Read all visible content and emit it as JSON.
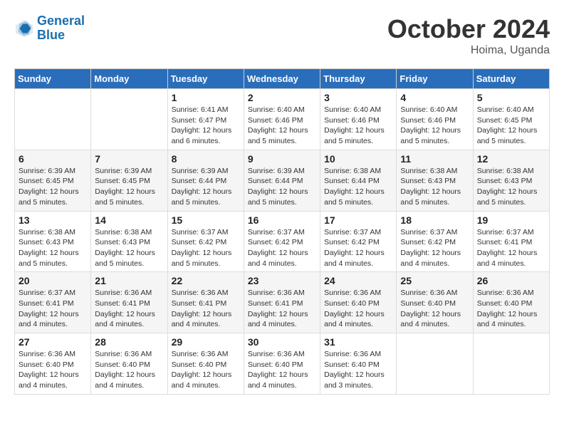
{
  "header": {
    "logo_general": "General",
    "logo_blue": "Blue",
    "month": "October 2024",
    "location": "Hoima, Uganda"
  },
  "weekdays": [
    "Sunday",
    "Monday",
    "Tuesday",
    "Wednesday",
    "Thursday",
    "Friday",
    "Saturday"
  ],
  "weeks": [
    [
      {
        "day": "",
        "info": ""
      },
      {
        "day": "",
        "info": ""
      },
      {
        "day": "1",
        "info": "Sunrise: 6:41 AM\nSunset: 6:47 PM\nDaylight: 12 hours and 6 minutes."
      },
      {
        "day": "2",
        "info": "Sunrise: 6:40 AM\nSunset: 6:46 PM\nDaylight: 12 hours and 5 minutes."
      },
      {
        "day": "3",
        "info": "Sunrise: 6:40 AM\nSunset: 6:46 PM\nDaylight: 12 hours and 5 minutes."
      },
      {
        "day": "4",
        "info": "Sunrise: 6:40 AM\nSunset: 6:46 PM\nDaylight: 12 hours and 5 minutes."
      },
      {
        "day": "5",
        "info": "Sunrise: 6:40 AM\nSunset: 6:45 PM\nDaylight: 12 hours and 5 minutes."
      }
    ],
    [
      {
        "day": "6",
        "info": "Sunrise: 6:39 AM\nSunset: 6:45 PM\nDaylight: 12 hours and 5 minutes."
      },
      {
        "day": "7",
        "info": "Sunrise: 6:39 AM\nSunset: 6:45 PM\nDaylight: 12 hours and 5 minutes."
      },
      {
        "day": "8",
        "info": "Sunrise: 6:39 AM\nSunset: 6:44 PM\nDaylight: 12 hours and 5 minutes."
      },
      {
        "day": "9",
        "info": "Sunrise: 6:39 AM\nSunset: 6:44 PM\nDaylight: 12 hours and 5 minutes."
      },
      {
        "day": "10",
        "info": "Sunrise: 6:38 AM\nSunset: 6:44 PM\nDaylight: 12 hours and 5 minutes."
      },
      {
        "day": "11",
        "info": "Sunrise: 6:38 AM\nSunset: 6:43 PM\nDaylight: 12 hours and 5 minutes."
      },
      {
        "day": "12",
        "info": "Sunrise: 6:38 AM\nSunset: 6:43 PM\nDaylight: 12 hours and 5 minutes."
      }
    ],
    [
      {
        "day": "13",
        "info": "Sunrise: 6:38 AM\nSunset: 6:43 PM\nDaylight: 12 hours and 5 minutes."
      },
      {
        "day": "14",
        "info": "Sunrise: 6:38 AM\nSunset: 6:43 PM\nDaylight: 12 hours and 5 minutes."
      },
      {
        "day": "15",
        "info": "Sunrise: 6:37 AM\nSunset: 6:42 PM\nDaylight: 12 hours and 5 minutes."
      },
      {
        "day": "16",
        "info": "Sunrise: 6:37 AM\nSunset: 6:42 PM\nDaylight: 12 hours and 4 minutes."
      },
      {
        "day": "17",
        "info": "Sunrise: 6:37 AM\nSunset: 6:42 PM\nDaylight: 12 hours and 4 minutes."
      },
      {
        "day": "18",
        "info": "Sunrise: 6:37 AM\nSunset: 6:42 PM\nDaylight: 12 hours and 4 minutes."
      },
      {
        "day": "19",
        "info": "Sunrise: 6:37 AM\nSunset: 6:41 PM\nDaylight: 12 hours and 4 minutes."
      }
    ],
    [
      {
        "day": "20",
        "info": "Sunrise: 6:37 AM\nSunset: 6:41 PM\nDaylight: 12 hours and 4 minutes."
      },
      {
        "day": "21",
        "info": "Sunrise: 6:36 AM\nSunset: 6:41 PM\nDaylight: 12 hours and 4 minutes."
      },
      {
        "day": "22",
        "info": "Sunrise: 6:36 AM\nSunset: 6:41 PM\nDaylight: 12 hours and 4 minutes."
      },
      {
        "day": "23",
        "info": "Sunrise: 6:36 AM\nSunset: 6:41 PM\nDaylight: 12 hours and 4 minutes."
      },
      {
        "day": "24",
        "info": "Sunrise: 6:36 AM\nSunset: 6:40 PM\nDaylight: 12 hours and 4 minutes."
      },
      {
        "day": "25",
        "info": "Sunrise: 6:36 AM\nSunset: 6:40 PM\nDaylight: 12 hours and 4 minutes."
      },
      {
        "day": "26",
        "info": "Sunrise: 6:36 AM\nSunset: 6:40 PM\nDaylight: 12 hours and 4 minutes."
      }
    ],
    [
      {
        "day": "27",
        "info": "Sunrise: 6:36 AM\nSunset: 6:40 PM\nDaylight: 12 hours and 4 minutes."
      },
      {
        "day": "28",
        "info": "Sunrise: 6:36 AM\nSunset: 6:40 PM\nDaylight: 12 hours and 4 minutes."
      },
      {
        "day": "29",
        "info": "Sunrise: 6:36 AM\nSunset: 6:40 PM\nDaylight: 12 hours and 4 minutes."
      },
      {
        "day": "30",
        "info": "Sunrise: 6:36 AM\nSunset: 6:40 PM\nDaylight: 12 hours and 4 minutes."
      },
      {
        "day": "31",
        "info": "Sunrise: 6:36 AM\nSunset: 6:40 PM\nDaylight: 12 hours and 3 minutes."
      },
      {
        "day": "",
        "info": ""
      },
      {
        "day": "",
        "info": ""
      }
    ]
  ]
}
